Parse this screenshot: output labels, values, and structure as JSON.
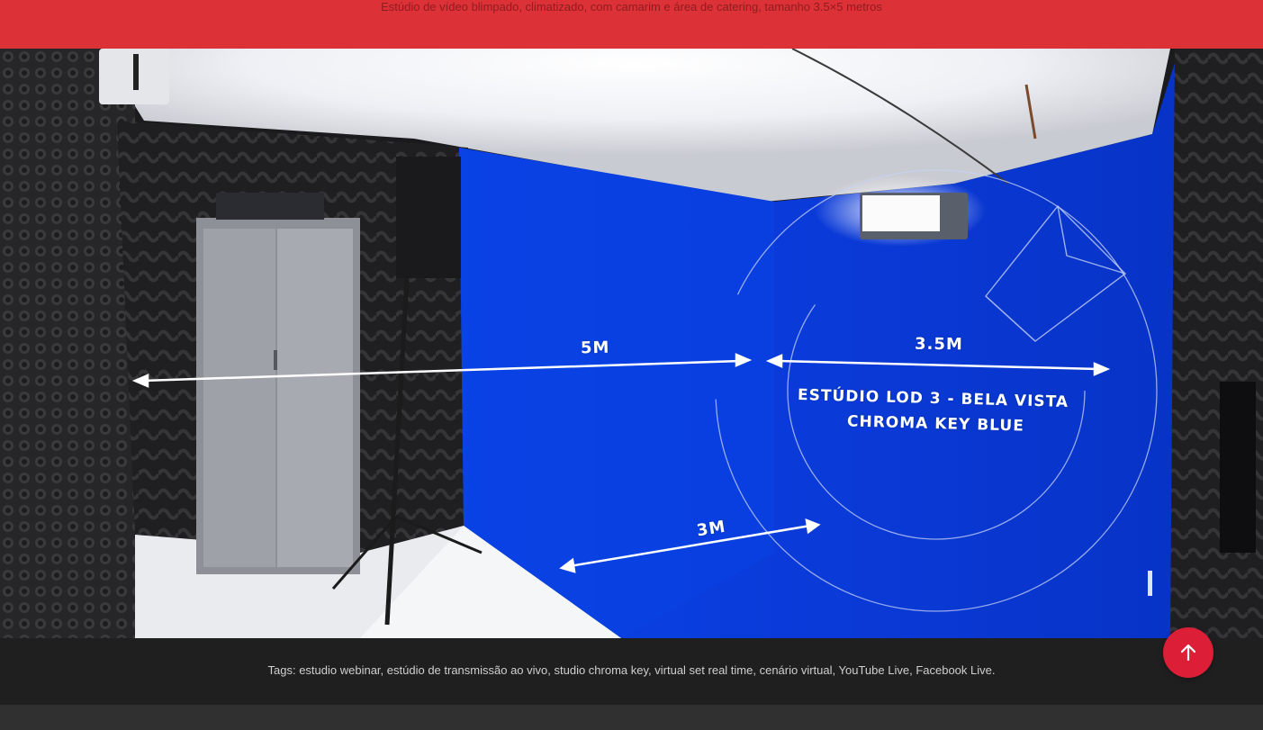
{
  "header": {
    "caption": "Estúdio de vídeo blimpado, climatizado, com camarim e área de catering, tamanho 3.5×5 metros"
  },
  "photo": {
    "dimension_labels": {
      "width": "5M",
      "depth": "3.5M",
      "floor": "3M"
    },
    "title_line1": "ESTÚDIO LOD 3 - BELA VISTA",
    "title_line2": "CHROMA KEY BLUE"
  },
  "tags": {
    "prefix": "Tags:",
    "items": [
      "estudio webinar",
      "estúdio de transmissão ao vivo",
      "studio chroma key",
      "virtual set real time",
      "cenário virtual",
      "YouTube Live",
      "Facebook Live."
    ]
  },
  "footer": {
    "peek_text": ""
  },
  "controls": {
    "scroll_top_icon": "arrow-up-icon"
  },
  "colors": {
    "brand_red": "#dc3237",
    "scroll_button": "#dc1e37",
    "chroma_blue": "#0a3cdc",
    "tags_bar": "#1f1f1f"
  }
}
